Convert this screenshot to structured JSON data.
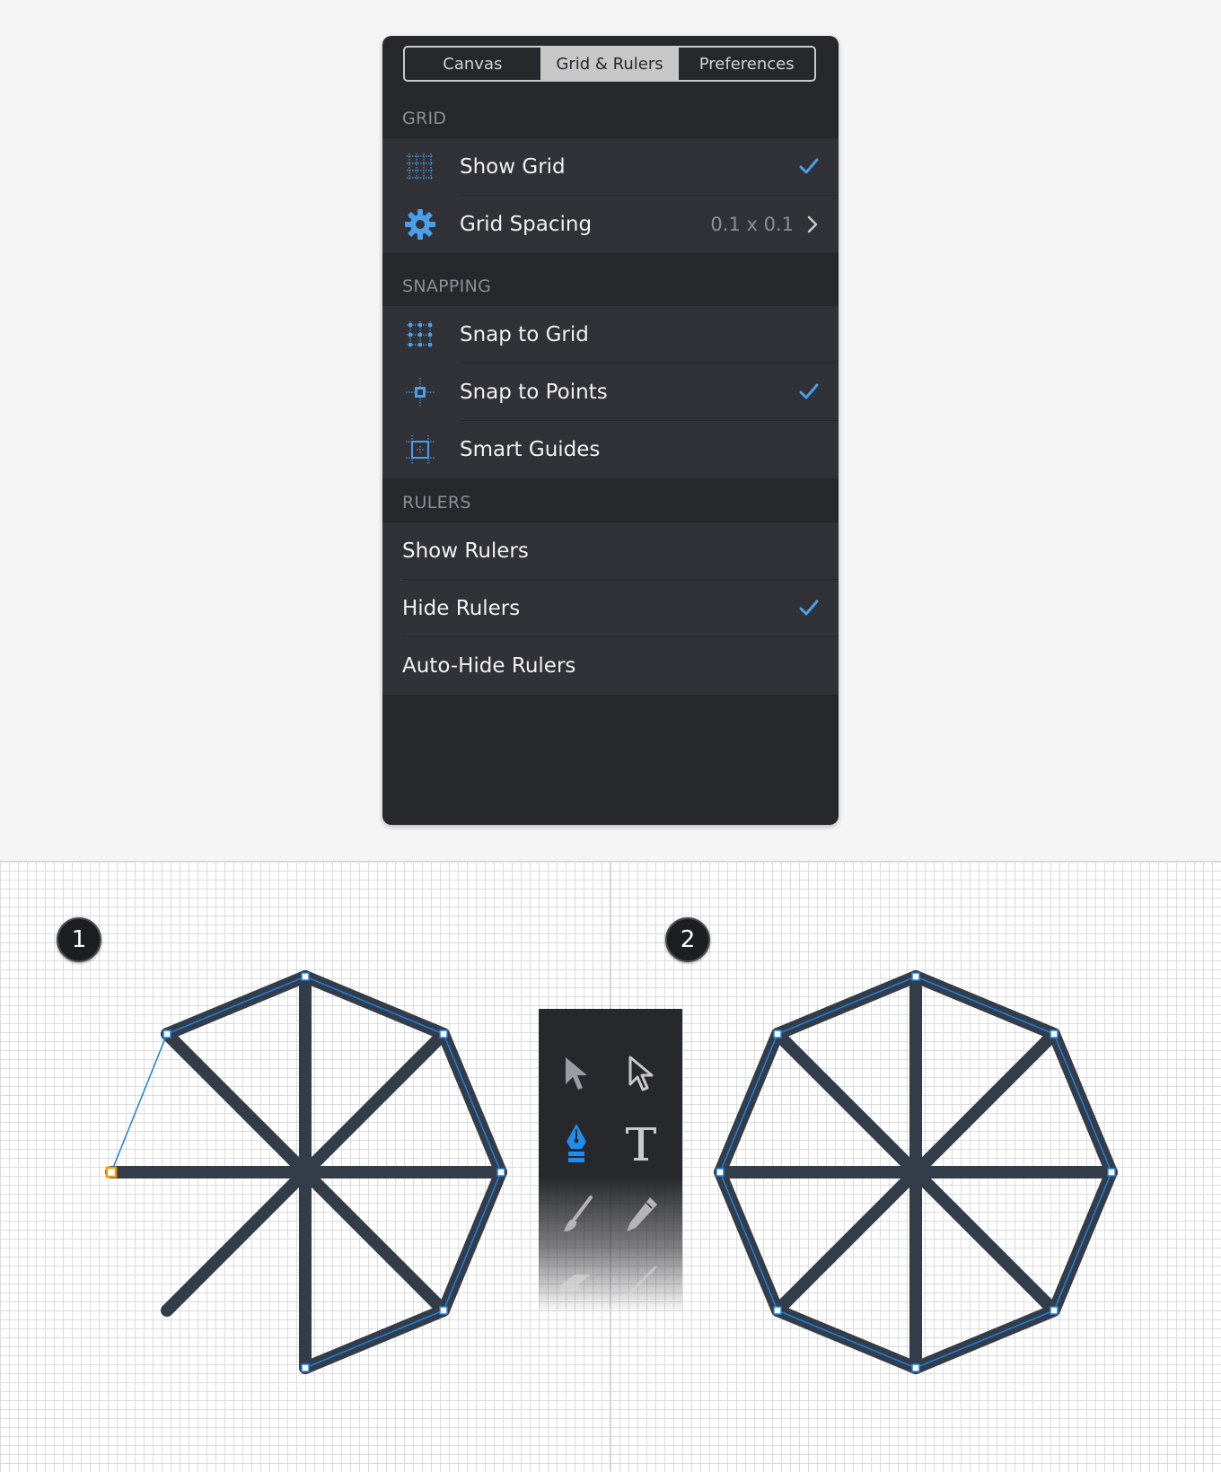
{
  "tabs": [
    {
      "label": "Canvas",
      "active": false
    },
    {
      "label": "Grid & Rulers",
      "active": true
    },
    {
      "label": "Preferences",
      "active": false
    }
  ],
  "sections": {
    "grid": {
      "header": "GRID",
      "show_grid": {
        "label": "Show Grid",
        "checked": true,
        "icon": "grid-icon"
      },
      "grid_spacing": {
        "label": "Grid Spacing",
        "value": "0.1 x 0.1",
        "icon": "gear-icon"
      }
    },
    "snapping": {
      "header": "SNAPPING",
      "snap_to_grid": {
        "label": "Snap to Grid",
        "checked": false,
        "icon": "snap-grid-icon"
      },
      "snap_to_points": {
        "label": "Snap to Points",
        "checked": true,
        "icon": "snap-point-icon"
      },
      "smart_guides": {
        "label": "Smart Guides",
        "checked": false,
        "icon": "smart-guides-icon"
      }
    },
    "rulers": {
      "header": "RULERS",
      "show_rulers": {
        "label": "Show Rulers",
        "checked": false
      },
      "hide_rulers": {
        "label": "Hide Rulers",
        "checked": true
      },
      "auto_hide_rulers": {
        "label": "Auto-Hide Rulers",
        "checked": false
      }
    }
  },
  "steps": [
    "1",
    "2"
  ],
  "tools": [
    "select-arrow-icon",
    "direct-select-arrow-icon",
    "pen-tool-icon",
    "text-tool-icon",
    "brush-tool-icon",
    "pencil-tool-icon",
    "eraser-tool-icon",
    "line-tool-icon"
  ],
  "colors": {
    "panel_bg": "#27282c",
    "row_bg": "#313237",
    "accent": "#4a9fe8",
    "stroke": "#333d4a",
    "selection": "#1f7fe0",
    "open_anchor": "#f39c12"
  }
}
